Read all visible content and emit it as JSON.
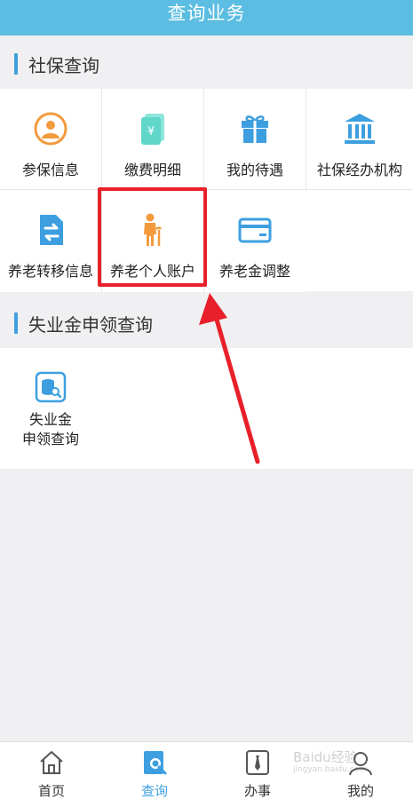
{
  "header": {
    "title": "查询业务"
  },
  "sections": {
    "social": {
      "title": "社保查询"
    },
    "unemployment": {
      "title": "失业金申领查询"
    }
  },
  "social_items": [
    {
      "label": "参保信息",
      "icon": "person-badge-icon"
    },
    {
      "label": "缴费明细",
      "icon": "fee-document-icon"
    },
    {
      "label": "我的待遇",
      "icon": "gift-icon"
    },
    {
      "label": "社保经办机构",
      "icon": "institution-icon"
    },
    {
      "label": "养老转移信息",
      "icon": "transfer-icon"
    },
    {
      "label": "养老个人账户",
      "icon": "elderly-icon"
    },
    {
      "label": "养老金调整",
      "icon": "card-icon"
    }
  ],
  "unemployment_items": [
    {
      "label": "失业金\n申领查询",
      "line1": "失业金",
      "line2": "申领查询",
      "icon": "database-search-icon"
    }
  ],
  "nav": [
    {
      "label": "首页",
      "icon": "home-icon",
      "active": false
    },
    {
      "label": "查询",
      "icon": "search-doc-icon",
      "active": true
    },
    {
      "label": "办事",
      "icon": "tie-icon",
      "active": false
    },
    {
      "label": "我的",
      "icon": "user-icon",
      "active": false
    }
  ],
  "colors": {
    "header": "#5bbde1",
    "accent": "#3d9fe0",
    "orange": "#f39a3d",
    "teal": "#5fd6c8",
    "highlight": "#e8202a"
  },
  "watermark": {
    "text": "Baidu经验",
    "sub": "jingyan.baidu.com"
  }
}
